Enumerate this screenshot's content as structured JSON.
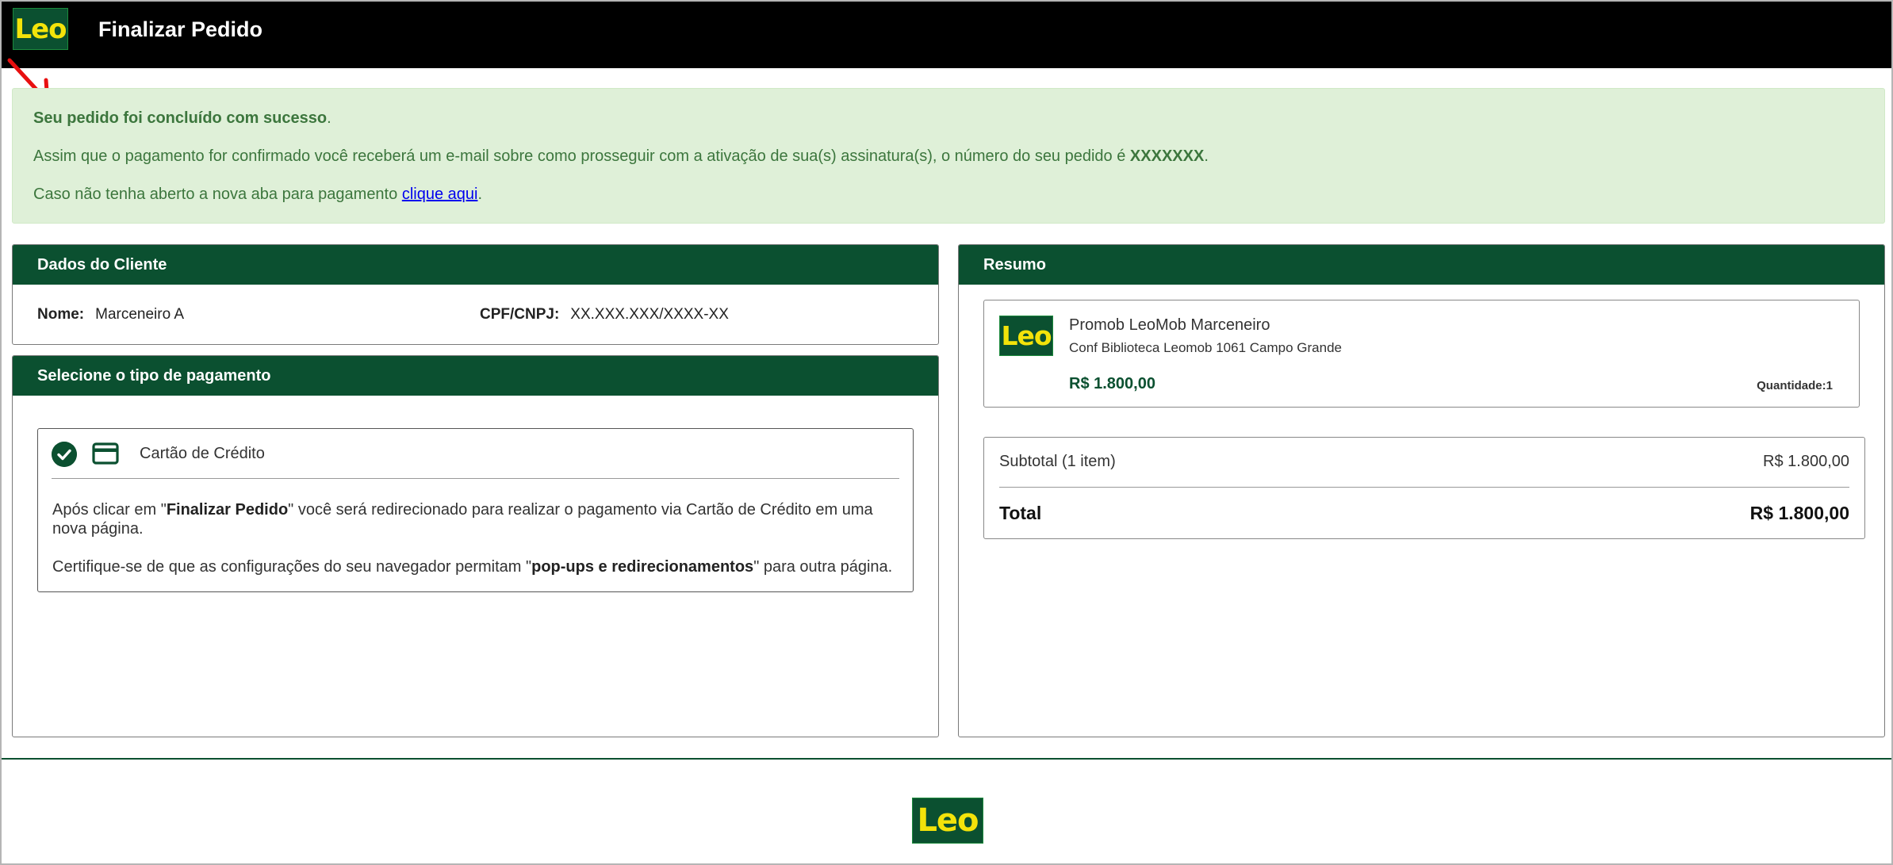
{
  "header": {
    "logo_text": "Leo",
    "title": "Finalizar Pedido"
  },
  "alert": {
    "success_bold": "Seu pedido foi concluído com sucesso",
    "success_tail": ".",
    "info_text": "Assim que o pagamento for confirmado você receberá um e-mail sobre como prosseguir com a ativação de sua(s) assinatura(s), o número do seu pedido é",
    "order_number": "XXXXXXX",
    "info_tail": ".",
    "tab_text": "Caso não tenha aberto a nova aba para pagamento",
    "tab_link": "clique aqui",
    "tab_tail": "."
  },
  "cliente": {
    "heading": "Dados do Cliente",
    "nome_label": "Nome:",
    "nome_value": "Marceneiro A",
    "cpf_label": "CPF/CNPJ:",
    "cpf_value": "XX.XXX.XXX/XXXX-XX"
  },
  "pagamento": {
    "heading": "Selecione o tipo de pagamento",
    "option_label": "Cartão de Crédito",
    "text1_a": "Após clicar em \"",
    "text1_bold": "Finalizar Pedido",
    "text1_b": "\" você será redirecionado para realizar o pagamento via Cartão de Crédito em uma nova página.",
    "text2_a": "Certifique-se de que as configurações do seu navegador permitam \"",
    "text2_bold": "pop-ups e redirecionamentos",
    "text2_b": "\" para outra página."
  },
  "resumo": {
    "heading": "Resumo",
    "product": {
      "logo_text": "Leo",
      "name": "Promob LeoMob Marceneiro",
      "description": "Conf Biblioteca Leomob 1061 Campo Grande",
      "price": "R$ 1.800,00",
      "quantity": "Quantidade:1"
    },
    "subtotal_label": "Subtotal (1 item)",
    "subtotal_value": "R$ 1.800,00",
    "total_label": "Total",
    "total_value": "R$ 1.800,00"
  },
  "footer": {
    "logo_text": "Leo"
  },
  "colors": {
    "brand_green": "#0b5030",
    "logo_yellow": "#f3e30a",
    "alert_bg": "#dff0d8",
    "alert_text": "#3c763d",
    "annotation_arrow": "#e81010"
  },
  "icons": {
    "selected": "check-circle-icon",
    "payment": "credit-card-icon",
    "annotation": "red-arrow-icon"
  }
}
